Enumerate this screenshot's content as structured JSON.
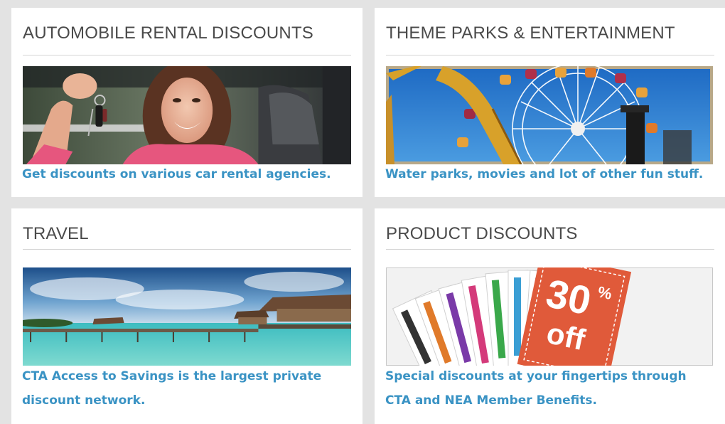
{
  "cards": [
    {
      "title": "AUTOMOBILE RENTAL DISCOUNTS",
      "caption": "Get discounts on various car rental agencies.",
      "image": "woman-with-car-keys-photo"
    },
    {
      "title": "THEME PARKS & ENTERTAINMENT",
      "caption": "Water parks, movies and lot of other fun stuff.",
      "image": "ferris-wheel-photo"
    },
    {
      "title": "TRAVEL",
      "caption": "CTA Access to Savings is the largest private discount network.",
      "image": "tropical-overwater-bungalows-photo"
    },
    {
      "title": "PRODUCT DISCOUNTS",
      "caption": "Special discounts at your fingertips through CTA and NEA Member Benefits.",
      "image": "discount-coupons-photo",
      "coupon_text": {
        "percent": "30",
        "symbol": "%",
        "off": "off"
      }
    }
  ],
  "colors": {
    "link": "#3a93c4",
    "heading": "#4a4a4a",
    "background": "#e3e3e3"
  }
}
